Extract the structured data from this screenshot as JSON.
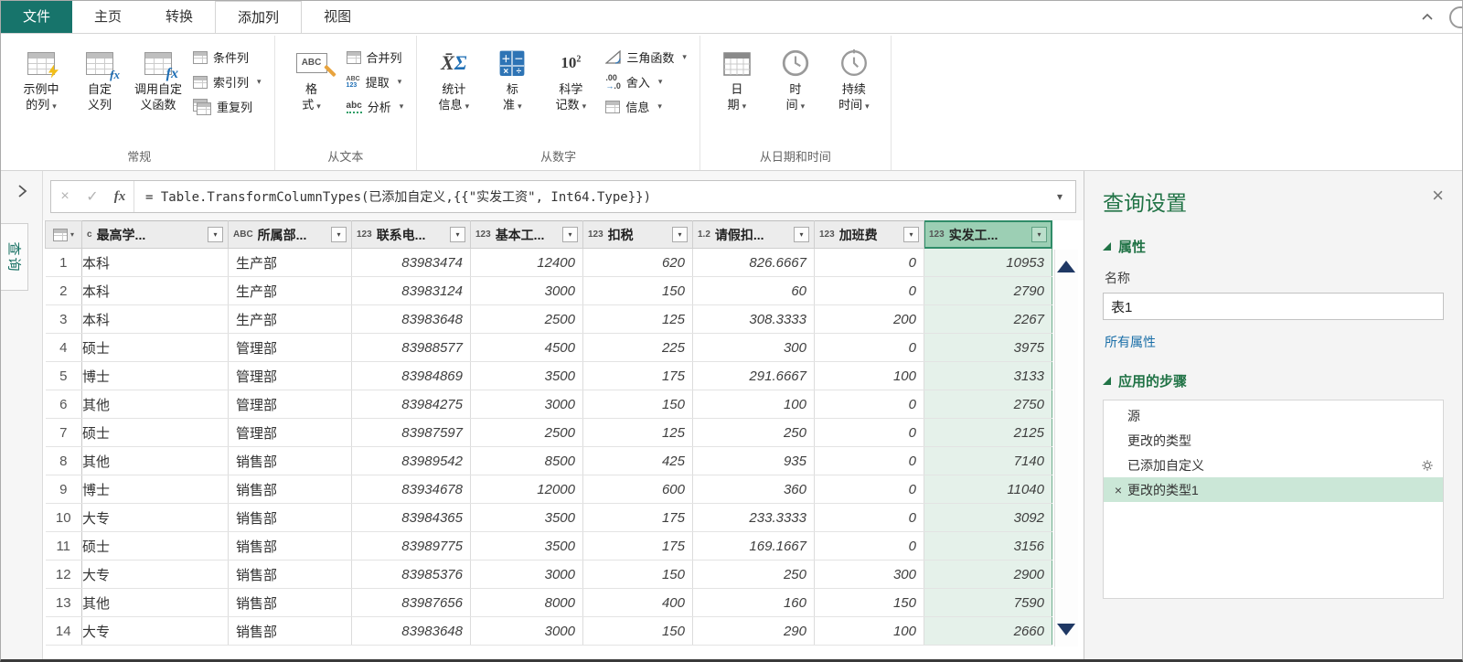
{
  "window": {
    "tabs": {
      "file": "文件",
      "home": "主页",
      "transform": "转换",
      "add_column": "添加列",
      "view": "视图"
    }
  },
  "ribbon": {
    "general": {
      "label": "常规",
      "col_from_examples": [
        "示例中",
        "的列"
      ],
      "custom_column": [
        "自定",
        "义列"
      ],
      "invoke_function": [
        "调用自定",
        "义函数"
      ],
      "conditional": "条件列",
      "index": "索引列",
      "duplicate": "重复列"
    },
    "from_text": {
      "label": "从文本",
      "format": [
        "格",
        "式"
      ],
      "merge": "合并列",
      "extract": "提取",
      "parse": "分析"
    },
    "from_number": {
      "label": "从数字",
      "statistics": [
        "统计",
        "信息"
      ],
      "standard": [
        "标",
        "准"
      ],
      "scientific": [
        "科学",
        "记数"
      ],
      "trig": "三角函数",
      "rounding": "舍入",
      "information": "信息"
    },
    "from_datetime": {
      "label": "从日期和时间",
      "date": [
        "日",
        "期"
      ],
      "time": [
        "时",
        "间"
      ],
      "duration": [
        "持续",
        "时间"
      ]
    }
  },
  "formula_bar": {
    "fx": "fx",
    "formula": "= Table.TransformColumnTypes(已添加自定义,{{\"实发工资\", Int64.Type}})"
  },
  "queries_pane": {
    "tab": "查询"
  },
  "grid": {
    "columns": [
      {
        "type_glyph": "c",
        "name": "最高学...",
        "kind": "text"
      },
      {
        "type_glyph": "ABC",
        "name": "所属部...",
        "kind": "text"
      },
      {
        "type_glyph": "123",
        "name": "联系电...",
        "kind": "number"
      },
      {
        "type_glyph": "123",
        "name": "基本工...",
        "kind": "number"
      },
      {
        "type_glyph": "123",
        "name": "扣税",
        "kind": "number"
      },
      {
        "type_glyph": "1.2",
        "name": "请假扣...",
        "kind": "number"
      },
      {
        "type_glyph": "123",
        "name": "加班费",
        "kind": "number"
      },
      {
        "type_glyph": "123",
        "name": "实发工...",
        "kind": "number",
        "selected": true
      }
    ],
    "rows": [
      {
        "n": "1",
        "cells": [
          "本科",
          "生产部",
          "83983474",
          "12400",
          "620",
          "826.6667",
          "0",
          "10953"
        ]
      },
      {
        "n": "2",
        "cells": [
          "本科",
          "生产部",
          "83983124",
          "3000",
          "150",
          "60",
          "0",
          "2790"
        ]
      },
      {
        "n": "3",
        "cells": [
          "本科",
          "生产部",
          "83983648",
          "2500",
          "125",
          "308.3333",
          "200",
          "2267"
        ]
      },
      {
        "n": "4",
        "cells": [
          "硕士",
          "管理部",
          "83988577",
          "4500",
          "225",
          "300",
          "0",
          "3975"
        ]
      },
      {
        "n": "5",
        "cells": [
          "博士",
          "管理部",
          "83984869",
          "3500",
          "175",
          "291.6667",
          "100",
          "3133"
        ]
      },
      {
        "n": "6",
        "cells": [
          "其他",
          "管理部",
          "83984275",
          "3000",
          "150",
          "100",
          "0",
          "2750"
        ]
      },
      {
        "n": "7",
        "cells": [
          "硕士",
          "管理部",
          "83987597",
          "2500",
          "125",
          "250",
          "0",
          "2125"
        ]
      },
      {
        "n": "8",
        "cells": [
          "其他",
          "销售部",
          "83989542",
          "8500",
          "425",
          "935",
          "0",
          "7140"
        ]
      },
      {
        "n": "9",
        "cells": [
          "博士",
          "销售部",
          "83934678",
          "12000",
          "600",
          "360",
          "0",
          "11040"
        ]
      },
      {
        "n": "10",
        "cells": [
          "大专",
          "销售部",
          "83984365",
          "3500",
          "175",
          "233.3333",
          "0",
          "3092"
        ]
      },
      {
        "n": "11",
        "cells": [
          "硕士",
          "销售部",
          "83989775",
          "3500",
          "175",
          "169.1667",
          "0",
          "3156"
        ]
      },
      {
        "n": "12",
        "cells": [
          "大专",
          "销售部",
          "83985376",
          "3000",
          "150",
          "250",
          "300",
          "2900"
        ]
      },
      {
        "n": "13",
        "cells": [
          "其他",
          "销售部",
          "83987656",
          "8000",
          "400",
          "160",
          "150",
          "7590"
        ]
      },
      {
        "n": "14",
        "cells": [
          "大专",
          "销售部",
          "83983648",
          "3000",
          "150",
          "290",
          "100",
          "2660"
        ]
      }
    ]
  },
  "settings_panel": {
    "title": "查询设置",
    "properties_header": "属性",
    "name_label": "名称",
    "name_value": "表1",
    "all_properties_link": "所有属性",
    "steps_header": "应用的步骤",
    "steps": [
      {
        "label": "源"
      },
      {
        "label": "更改的类型"
      },
      {
        "label": "已添加自定义",
        "gear": true
      },
      {
        "label": "更改的类型1",
        "selected": true,
        "deletable": true
      }
    ]
  },
  "colors": {
    "brand_green": "#217346",
    "file_tab_teal": "#17746B",
    "selected_column_header": "#9CCFB4",
    "selected_column_cell": "#E5F1EA",
    "selected_step_bg": "#CBE7D7",
    "scroll_arrow_navy": "#1F3864"
  }
}
